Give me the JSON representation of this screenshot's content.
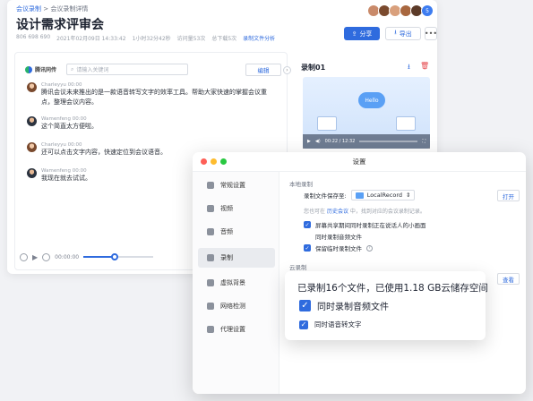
{
  "meeting_window": {
    "breadcrumb": {
      "link": "会议录制",
      "separator": ">",
      "current": "会议录制详情"
    },
    "title": "设计需求评审会",
    "meta": {
      "id": "806 698 690",
      "datetime": "2021年02月09日 14:33:42",
      "duration": "1小时32分42秒",
      "views": "访问量53次",
      "downloads": "总下载5次",
      "analysis_link": "录制文件分析"
    },
    "participants": {
      "count_badge": "5"
    },
    "buttons": {
      "share": "分享",
      "export": "导出",
      "more": "•••"
    },
    "transcript": {
      "brand": "腾讯同传",
      "search_placeholder": "请输入关键词",
      "edit": "编辑",
      "messages": [
        {
          "speaker": "Charleyyu 00:00",
          "text": "腾讯会议未来推出的是一款语音转写文字的效率工具。帮助大家快速的掌握会议重点，整理会议内容。"
        },
        {
          "speaker": "Wamenfeng 00:00",
          "text": "这个简直太方便啦。"
        },
        {
          "speaker": "Charleyyu 00:00",
          "text": "还可以点击文字内容，快速定位到会议语音。"
        },
        {
          "speaker": "Wamenfeng 00:00",
          "text": "我现在就去试试。"
        }
      ]
    },
    "player": {
      "time": "00:00:00",
      "progress": 0.45
    },
    "recording": {
      "title": "录制01",
      "cloud_label": "Hello",
      "video_time": "00:22 / 12:32"
    }
  },
  "settings_dialog": {
    "title": "设置",
    "sidebar": [
      {
        "label": "常规设置",
        "icon": "gear-icon"
      },
      {
        "label": "视频",
        "icon": "camera-icon"
      },
      {
        "label": "音频",
        "icon": "speaker-icon"
      },
      {
        "label": "录制",
        "icon": "record-icon",
        "active": true
      },
      {
        "label": "虚拟背景",
        "icon": "background-icon"
      },
      {
        "label": "网络检测",
        "icon": "network-icon"
      },
      {
        "label": "代理设置",
        "icon": "proxy-icon"
      }
    ],
    "local": {
      "section": "本地录制",
      "save_location_label": "录制文件保存至:",
      "folder": "LocalRecord",
      "open_button": "打开",
      "hint_pre": "您也可在",
      "hint_link": "历史会议",
      "hint_post": "中，找到对应的会议录制记录。",
      "options": [
        "屏幕共享期间同时录制正在说话人的小画面",
        "同时录制音频文件",
        "保留临时录制文件"
      ]
    },
    "cloud": {
      "section": "云录制",
      "view_button": "查看"
    }
  },
  "zoom_callout": {
    "storage_text": "已录制16个文件，已使用1.18 GB云储存空间",
    "option1": "同时录制音频文件",
    "option2": "同时语音转文字"
  },
  "colors": {
    "accent": "#2f6bde",
    "danger": "#e5484d"
  }
}
